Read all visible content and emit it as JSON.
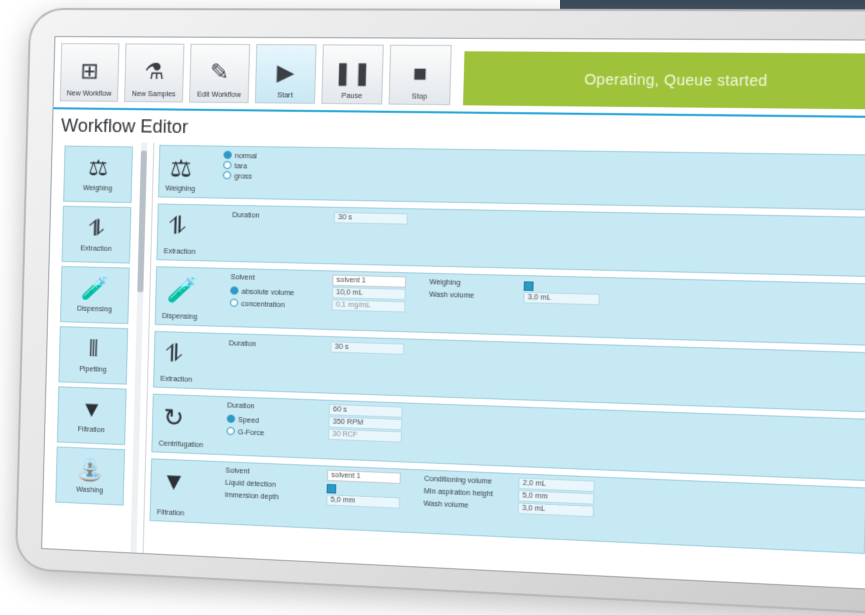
{
  "toolbar": {
    "buttons": [
      {
        "label": "New Workflow",
        "icon": "new-workflow-icon"
      },
      {
        "label": "New Samples",
        "icon": "new-samples-icon"
      },
      {
        "label": "Edit Workflow",
        "icon": "edit-workflow-icon"
      },
      {
        "label": "Start",
        "icon": "play-icon"
      },
      {
        "label": "Pause",
        "icon": "pause-icon"
      },
      {
        "label": "Stop",
        "icon": "stop-icon"
      }
    ],
    "status": "Operating, Queue started"
  },
  "page_title": "Workflow Editor",
  "sidebar": {
    "items": [
      {
        "label": "Weighing",
        "icon": "balance-icon"
      },
      {
        "label": "Extraction",
        "icon": "extraction-icon"
      },
      {
        "label": "Dispensing",
        "icon": "dispensing-icon"
      },
      {
        "label": "Pipetting",
        "icon": "pipetting-icon"
      },
      {
        "label": "Filtration",
        "icon": "funnel-icon"
      },
      {
        "label": "Washing",
        "icon": "washing-icon"
      }
    ]
  },
  "steps": {
    "weighing": {
      "name": "Weighing",
      "options": [
        "normal",
        "tara",
        "gross"
      ],
      "selected": "normal"
    },
    "extraction1": {
      "name": "Extraction",
      "duration_label": "Duration",
      "duration_value": "30 s"
    },
    "dispensing": {
      "name": "Dispensing",
      "solvent_label": "Solvent",
      "solvent_value": "solvent 1",
      "opt_absolute": "absolute volume",
      "absolute_value": "10,0 mL",
      "opt_concentration": "concentration",
      "concentration_value": "0,1 mg/mL",
      "weighing_label": "Weighing",
      "wash_label": "Wash volume",
      "wash_value": "3,0 mL"
    },
    "extraction2": {
      "name": "Extraction",
      "duration_label": "Duration",
      "duration_value": "30 s"
    },
    "centrifugation": {
      "name": "Centrifugation",
      "duration_label": "Duration",
      "duration_value": "60 s",
      "speed_label": "Speed",
      "speed_value": "350 RPM",
      "gforce_label": "G-Force",
      "gforce_value": "30 RCF"
    },
    "filtration": {
      "name": "Filtration",
      "solvent_label": "Solvent",
      "solvent_value": "solvent 1",
      "liquid_label": "Liquid detection",
      "immersion_label": "Immersion depth",
      "immersion_value": "5,0 mm",
      "cond_label": "Conditioning volume",
      "cond_value": "2,0 mL",
      "aspir_label": "Min aspiration height",
      "aspir_value": "5,0 mm",
      "wash_label": "Wash volume",
      "wash_value": "3,0 mL"
    }
  },
  "colors": {
    "accent": "#29a7d8",
    "status": "#9ec33b",
    "panel": "#c7e9f4"
  }
}
